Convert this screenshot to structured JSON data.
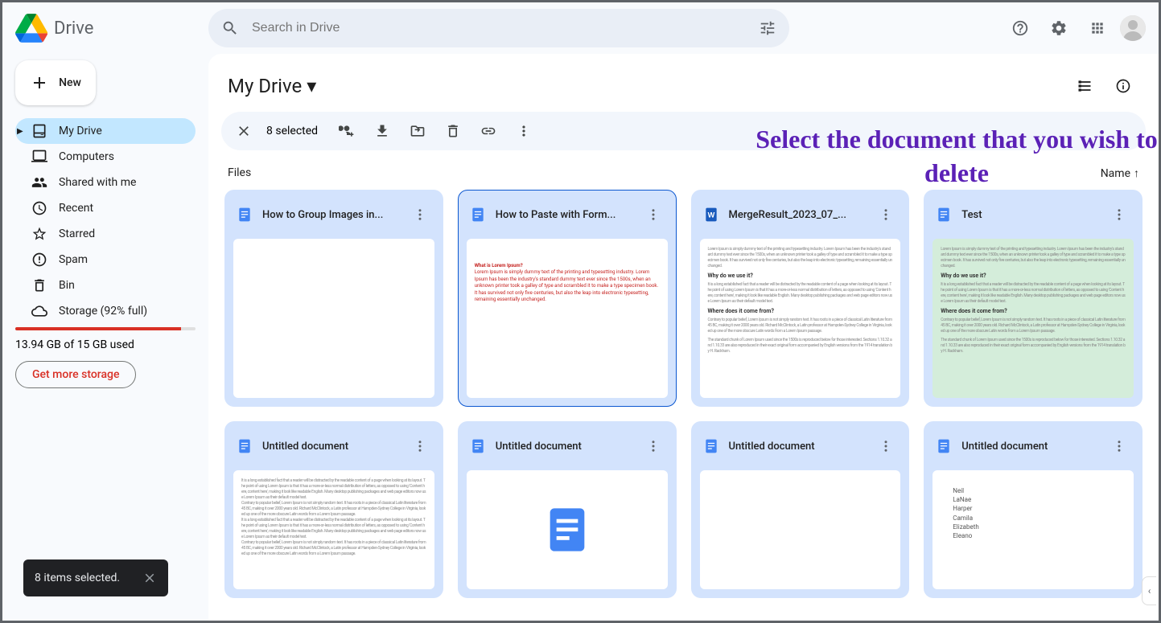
{
  "app_name": "Drive",
  "search": {
    "placeholder": "Search in Drive"
  },
  "sidebar": {
    "new_label": "New",
    "items": [
      {
        "label": "My Drive"
      },
      {
        "label": "Computers"
      },
      {
        "label": "Shared with me"
      },
      {
        "label": "Recent"
      },
      {
        "label": "Starred"
      },
      {
        "label": "Spam"
      },
      {
        "label": "Bin"
      },
      {
        "label": "Storage (92% full)"
      }
    ],
    "storage_used": "13.94 GB of 15 GB used",
    "get_storage": "Get more storage"
  },
  "breadcrumb": {
    "title": "My Drive"
  },
  "selection": {
    "count_label": "8 selected"
  },
  "files_section": {
    "label": "Files",
    "sort": "Name"
  },
  "files": [
    {
      "title": "How to Group Images in...",
      "type": "docs"
    },
    {
      "title": "How to Paste with Form...",
      "type": "docs"
    },
    {
      "title": "MergeResult_2023_07_...",
      "type": "word"
    },
    {
      "title": "Test",
      "type": "docs"
    },
    {
      "title": "Untitled document",
      "type": "docs"
    },
    {
      "title": "Untitled document",
      "type": "docs"
    },
    {
      "title": "Untitled document",
      "type": "docs"
    },
    {
      "title": "Untitled document",
      "type": "docs"
    }
  ],
  "annotation": "Select the document that you wish to delete",
  "toast": {
    "message": "8 items selected."
  },
  "lorem_preview": {
    "q": "What is Lorem Ipsum?",
    "red_body": "Lorem Ipsum is simply dummy text of the printing and typesetting industry. Lorem Ipsum has been the industry's standard dummy text ever since the 1500s, when an unknown printer took a galley of type and scrambled it to make a type specimen book. It has survived not only five centuries, but also the leap into electronic typesetting, remaining essentially unchanged.",
    "h1": "Why do we use it?",
    "p1": "It is a long established fact that a reader will be distracted by the readable content of a page when looking at its layout. The point of using Lorem Ipsum is that it has a more-or-less normal distribution of letters, as opposed to using 'Content here, content here', making it look like readable English. Many desktop publishing packages and web page editors now use Lorem Ipsum as their default model text.",
    "h2": "Where does it come from?",
    "p2": "Contrary to popular belief, Lorem Ipsum is not simply random text. It has roots in a piece of classical Latin literature from 45 BC, making it over 2000 years old. Richard McClintock, a Latin professor at Hampden-Sydney College in Virginia, looked up one of the more obscure Latin words from a Lorem Ipsum passage.",
    "p3": "The standard chunk of Lorem Ipsum used since the 1500s is reproduced below for those interested. Sections 1.10.32 and 1.10.33 are also reproduced in their exact original form accompanied by English versions from the 1914 translation by H. Rackham.",
    "names": "Neil\nLaNae\nHarper\nCamila\nElizabeth\nEleano"
  }
}
